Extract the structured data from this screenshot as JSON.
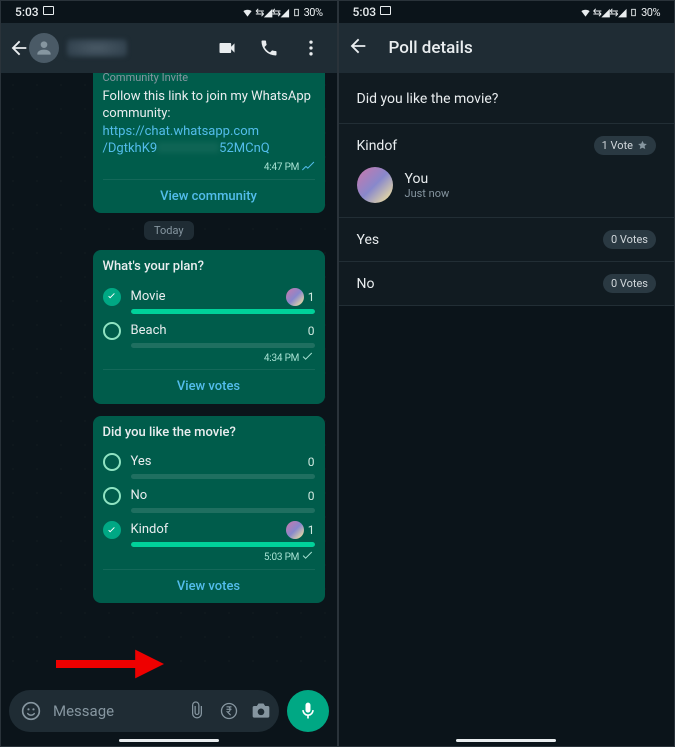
{
  "statusbar": {
    "time": "5:03",
    "battery": "30%"
  },
  "chat": {
    "community_msg": {
      "header": "Community Invite",
      "text": "Follow this link to join my WhatsApp community:",
      "link1": "https://chat.whatsapp.com",
      "link2a": "/DgtkhK9",
      "link2b": "52MCnQ",
      "time": "4:47 PM",
      "action": "View community"
    },
    "date_chip": "Today",
    "poll1": {
      "question": "What's your plan?",
      "options": [
        {
          "label": "Movie",
          "count": "1",
          "checked": true,
          "fill": 100
        },
        {
          "label": "Beach",
          "count": "0",
          "checked": false,
          "fill": 0
        }
      ],
      "time": "4:34 PM",
      "action": "View votes"
    },
    "poll2": {
      "question": "Did you like the movie?",
      "options": [
        {
          "label": "Yes",
          "count": "0",
          "checked": false,
          "fill": 0
        },
        {
          "label": "No",
          "count": "0",
          "checked": false,
          "fill": 0
        },
        {
          "label": "Kindof",
          "count": "1",
          "checked": true,
          "fill": 100
        }
      ],
      "time": "5:03 PM",
      "action": "View votes"
    },
    "input_placeholder": "Message"
  },
  "details": {
    "title": "Poll details",
    "question": "Did you like the movie?",
    "options": [
      {
        "label": "Kindof",
        "badge": "1 Vote",
        "star": true,
        "voter": {
          "name": "You",
          "sub": "Just now"
        }
      },
      {
        "label": "Yes",
        "badge": "0 Votes"
      },
      {
        "label": "No",
        "badge": "0 Votes"
      }
    ]
  }
}
